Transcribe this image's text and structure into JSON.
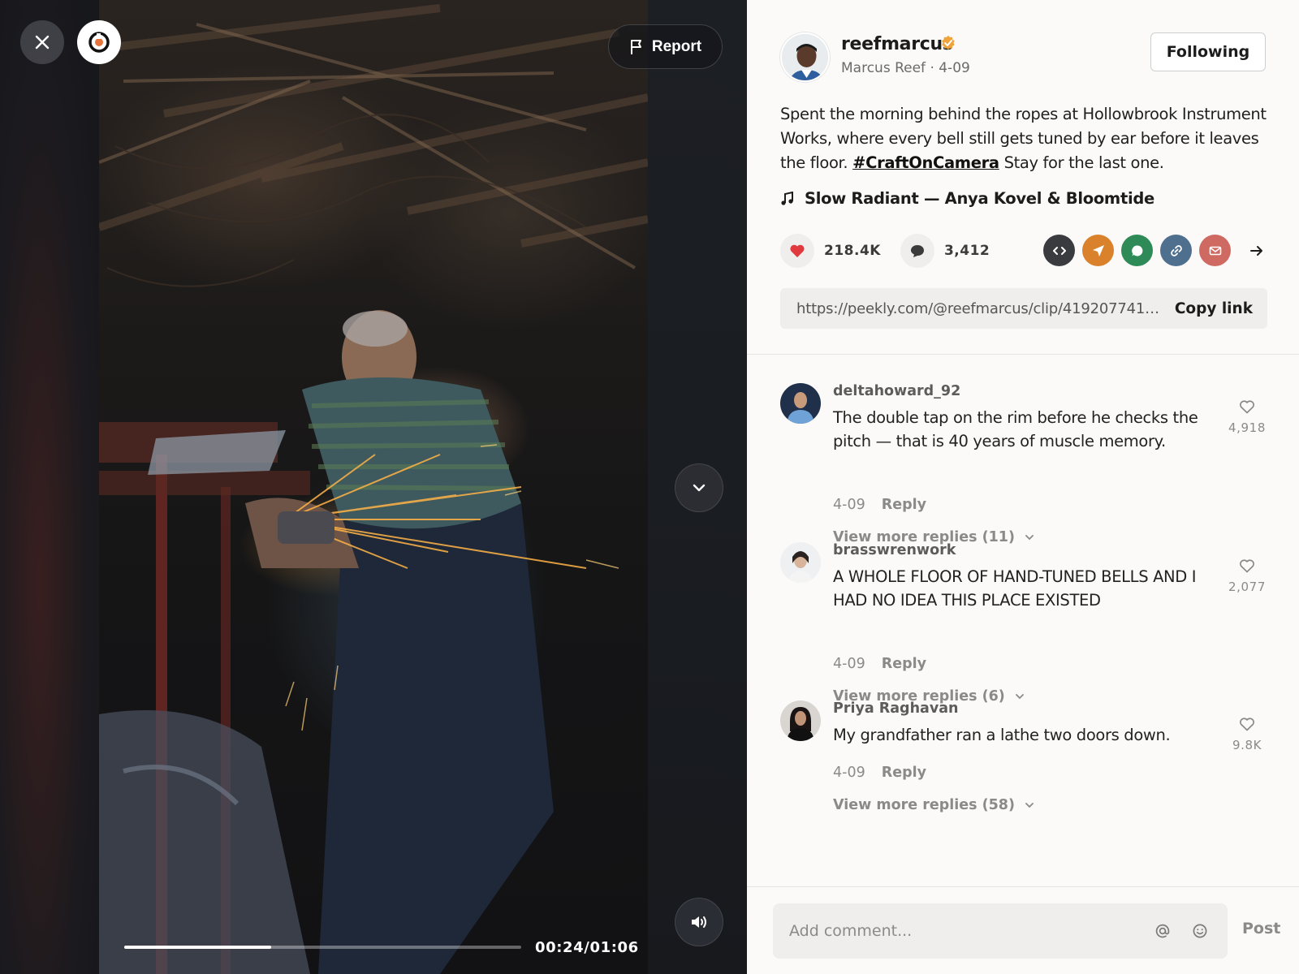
{
  "video": {
    "report_label": "Report",
    "time": "00:24/01:06",
    "progress": 0.37
  },
  "post": {
    "username": "reefmarcus",
    "meta": "Marcus Reef · 4-09",
    "follow_label": "Following",
    "caption_pre": "Spent the morning behind the ropes at Hollowbrook Instrument Works, where every bell still gets tuned by ear before it leaves the floor. ",
    "hashtag": "#CraftOnCamera",
    "caption_post": " Stay for the last one.",
    "music": "Slow Radiant — Anya Kovel & Bloomtide",
    "likes": "218.4K",
    "comments_count": "3,412",
    "share_icons": [
      {
        "name": "embed-icon",
        "color": "#3a3b3f"
      },
      {
        "name": "send-icon",
        "color": "#d9822b"
      },
      {
        "name": "whatsapp-icon",
        "color": "#2e8b57"
      },
      {
        "name": "link-icon",
        "color": "#4f6f8f"
      },
      {
        "name": "mail-icon",
        "color": "#cf6a62"
      }
    ],
    "link_url": "https://peekly.com/@reefmarcus/clip/41920774163...",
    "copy_label": "Copy link"
  },
  "comments": [
    {
      "user": "deltahoward_92",
      "text": "The double tap on the rim before he checks the pitch — that is 40 years of muscle memory.",
      "likes": "4,918",
      "date": "4-09",
      "reply_label": "Reply",
      "more": "View more replies (11)"
    },
    {
      "user": "brasswrenwork",
      "text": "A WHOLE FLOOR OF HAND-TUNED BELLS AND I HAD NO IDEA THIS PLACE EXISTED",
      "likes": "2,077",
      "date": "4-09",
      "reply_label": "Reply",
      "more": "View more replies (6)"
    },
    {
      "user": "Priya Raghavan",
      "text": "My grandfather ran a lathe two doors down.",
      "likes": "9.8K",
      "date": "4-09",
      "reply_label": "Reply",
      "more": "View more replies (58)"
    }
  ],
  "composer": {
    "placeholder": "Add comment...",
    "post_label": "Post"
  },
  "colors": {
    "accent_like": "#e0393e",
    "verified": "#f0a23b"
  }
}
